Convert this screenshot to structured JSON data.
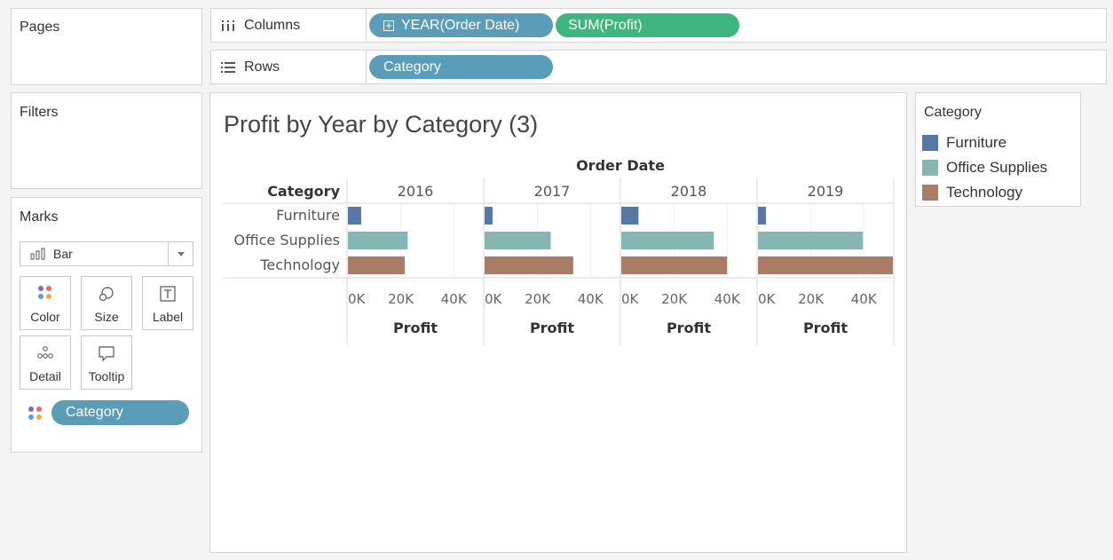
{
  "shelves": {
    "pages_label": "Pages",
    "columns_label": "Columns",
    "rows_label": "Rows",
    "columns_pills": [
      {
        "label": "YEAR(Order Date)",
        "prefix": "⊞",
        "color": "#5b9cb8"
      },
      {
        "label": "SUM(Profit)",
        "color": "#3fb67f"
      }
    ],
    "rows_pills": [
      {
        "label": "Category",
        "color": "#5b9cb8"
      }
    ]
  },
  "filters": {
    "label": "Filters"
  },
  "marks": {
    "label": "Marks",
    "mark_type": "Bar",
    "buttons": {
      "color": "Color",
      "size": "Size",
      "label": "Label",
      "detail": "Detail",
      "tooltip": "Tooltip"
    },
    "color_pill": "Category"
  },
  "view": {
    "title": "Profit by Year by Category (3)"
  },
  "legend": {
    "title": "Category",
    "items": [
      {
        "label": "Furniture",
        "color": "#5778a4"
      },
      {
        "label": "Office Supplies",
        "color": "#85b6b2"
      },
      {
        "label": "Technology",
        "color": "#a87c66"
      }
    ]
  },
  "chart_data": {
    "type": "bar",
    "orientation": "horizontal",
    "column_header": "Order Date",
    "row_header": "Category",
    "panes": [
      "2016",
      "2017",
      "2018",
      "2019"
    ],
    "categories": [
      "Furniture",
      "Office Supplies",
      "Technology"
    ],
    "colors": [
      "#5778a4",
      "#85b6b2",
      "#a87c66"
    ],
    "values": {
      "2016": [
        5000,
        22600,
        21500
      ],
      "2017": [
        3000,
        25000,
        33500
      ],
      "2018": [
        6500,
        35000,
        40000
      ],
      "2019": [
        3000,
        39700,
        51000
      ]
    },
    "xlabel": "Profit",
    "ticks": [
      0,
      20000,
      40000
    ],
    "tick_labels": [
      "0K",
      "20K",
      "40K"
    ],
    "xlim": [
      0,
      51000
    ]
  }
}
